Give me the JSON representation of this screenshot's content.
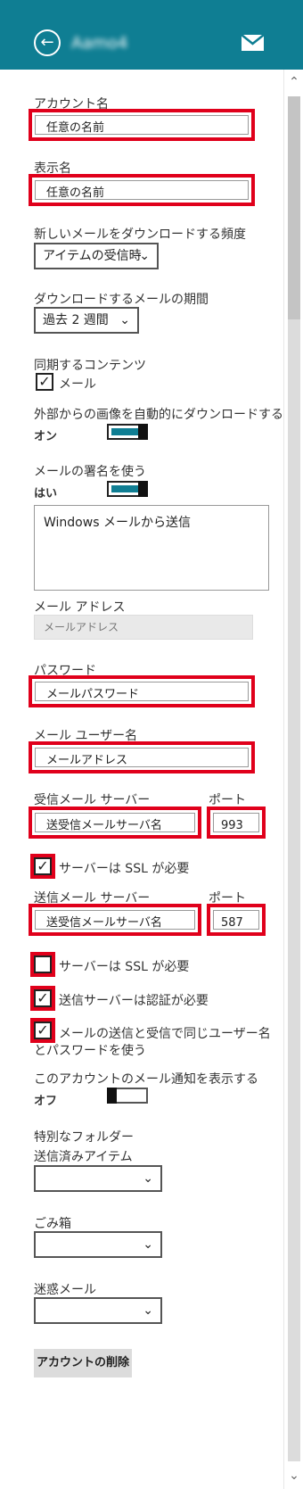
{
  "header": {
    "account_name": "Aamo4",
    "back_icon": "back-arrow-icon",
    "mail_icon": "mail-icon"
  },
  "fields": {
    "account_name_label": "アカウント名",
    "account_name_value": "任意の名前",
    "display_name_label": "表示名",
    "display_name_value": "任意の名前",
    "download_freq_label": "新しいメールをダウンロードする頻度",
    "download_freq_value": "アイテムの受信時",
    "download_period_label": "ダウンロードするメールの期間",
    "download_period_value": "過去 2 週間",
    "sync_label": "同期するコンテンツ",
    "sync_mail": "メール",
    "external_images_label": "外部からの画像を自動的にダウンロードする",
    "external_images_state": "オン",
    "signature_label": "メールの署名を使う",
    "signature_state": "はい",
    "signature_text": "Windows メールから送信",
    "email_label": "メール アドレス",
    "email_placeholder": "メールアドレス",
    "password_label": "パスワード",
    "password_value": "メールパスワード",
    "username_label": "メール ユーザー名",
    "username_value": "メールアドレス",
    "incoming_label": "受信メール サーバー",
    "incoming_port_label": "ポート",
    "incoming_server": "送受信メールサーバ名",
    "incoming_port": "993",
    "incoming_ssl": "サーバーは SSL が必要",
    "outgoing_label": "送信メール サーバー",
    "outgoing_port_label": "ポート",
    "outgoing_server": "送受信メールサーバ名",
    "outgoing_port": "587",
    "outgoing_ssl": "サーバーは SSL が必要",
    "outgoing_auth": "送信サーバーは認証が必要",
    "same_credentials_1": "メールの送信と受信で同じユーザー名",
    "same_credentials_2": "とパスワードを使う",
    "notifications_label": "このアカウントのメール通知を表示する",
    "notifications_state": "オフ",
    "special_folders_label": "特別なフォルダー",
    "sent_items_label": "送信済みアイテム",
    "trash_label": "ごみ箱",
    "junk_label": "迷惑メール",
    "delete_button": "アカウントの削除"
  },
  "colors": {
    "header": "#0f7e93",
    "highlight": "#e0001b"
  }
}
